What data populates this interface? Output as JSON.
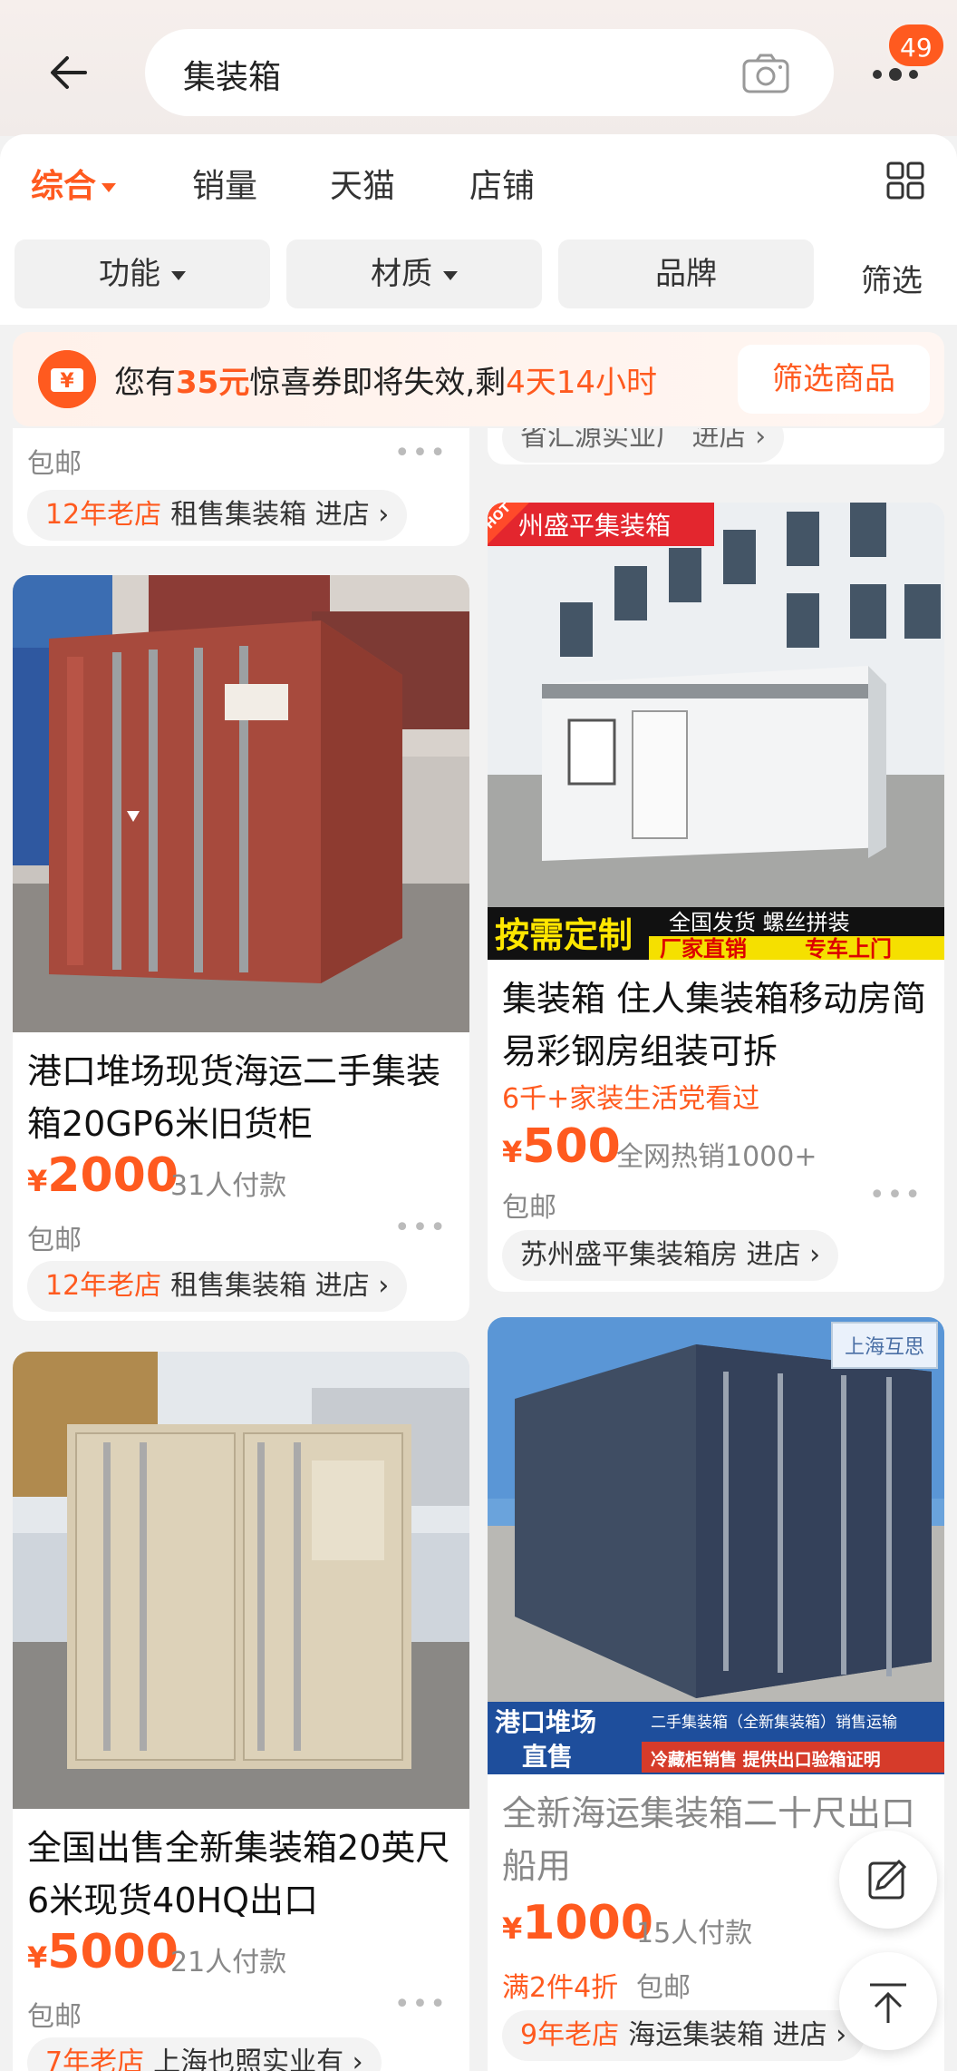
{
  "header": {
    "search_query": "集装箱",
    "notification_count": "49"
  },
  "sort_tabs": [
    {
      "label": "综合"
    },
    {
      "label": "销量"
    },
    {
      "label": "天猫"
    },
    {
      "label": "店铺"
    }
  ],
  "filters": {
    "chips": [
      {
        "label": "功能"
      },
      {
        "label": "材质"
      },
      {
        "label": "品牌"
      }
    ],
    "filter_label": "筛选"
  },
  "coupon": {
    "prefix": "您有",
    "amount": "35元",
    "middle": "惊喜券即将失效,剩",
    "time": "4天14小时",
    "button": "筛选商品"
  },
  "partial_top": {
    "left_free": "包邮",
    "left_shop_age": "12年老店",
    "left_shop_name": "租售集装箱 进店",
    "right_shop_text": "省汇源实业厂 进店"
  },
  "products": [
    {
      "image_overlay": "",
      "title": "港口堆场现货海运二手集装箱20GP6米旧货柜",
      "price_symbol": "¥",
      "price": "2000",
      "sold": "31人付款",
      "shipping": "包邮",
      "shop_age": "12年老店",
      "shop_name": "租售集装箱 进店"
    },
    {
      "image_overlay": "州盛平集装箱",
      "image_tag": "HOT",
      "banner_left": "按需定制",
      "banner_top": "全国发货  螺丝拼装",
      "banner_b1": "厂家直销",
      "banner_b2": "专车上门",
      "title": "集装箱  住人集装箱移动房简易彩钢房组装可拆",
      "promo": "6千+家装生活党看过",
      "price_symbol": "¥",
      "price": "500",
      "sold": "全网热销1000+",
      "shipping": "包邮",
      "shop_name": "苏州盛平集装箱房 进店"
    },
    {
      "title": "全国出售全新集装箱20英尺6米现货40HQ出口",
      "price_symbol": "¥",
      "price": "5000",
      "sold": "21人付款",
      "shipping": "包邮",
      "shop_age": "7年老店",
      "shop_name": "上海也照实业有"
    },
    {
      "image_corner": "上海互思",
      "banner_left_1": "港口堆场",
      "banner_left_2": "直售",
      "banner_r1": "二手集装箱（全新集装箱）销售运输",
      "banner_r2": "冷藏柜销售  提供出口验箱证明",
      "title": "全新海运集装箱二十尺出口船用",
      "price_symbol": "¥",
      "price": "1000",
      "sold": "15人付款",
      "promo": "满2件4折",
      "shipping": "包邮",
      "shop_age": "9年老店",
      "shop_name": "海运集装箱 进店"
    }
  ],
  "colors": {
    "accent": "#ff5a1f",
    "muted": "#888888"
  }
}
